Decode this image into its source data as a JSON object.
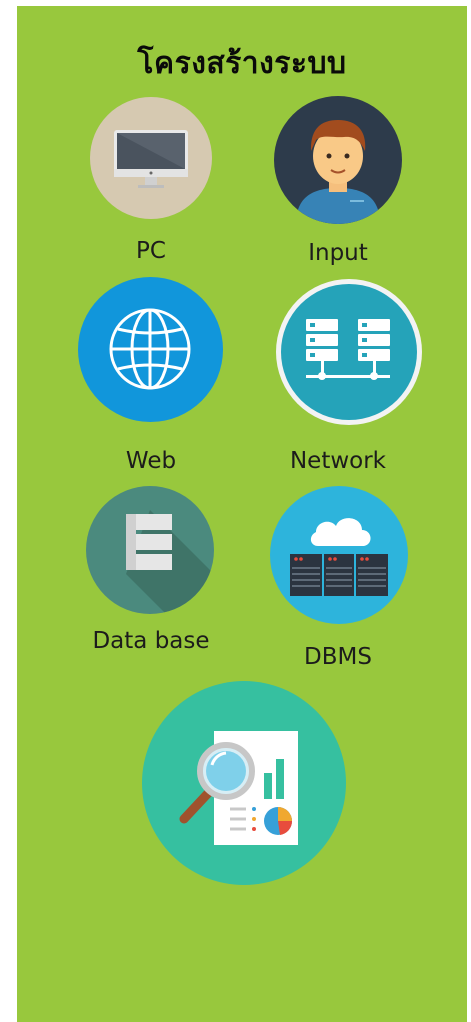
{
  "title": "โครงสร้างระบบ",
  "items": [
    {
      "label": "PC",
      "icon": "monitor-icon",
      "color": "#d6c9b1"
    },
    {
      "label": "Input",
      "icon": "person-avatar-icon",
      "color": "#2d3b4b"
    },
    {
      "label": "Web",
      "icon": "globe-icon",
      "color": "#1196db"
    },
    {
      "label": "Network",
      "icon": "server-network-icon",
      "color": "#25a3b9"
    },
    {
      "label": "Data base",
      "icon": "database-icon",
      "color": "#4b8a7e"
    },
    {
      "label": "DBMS",
      "icon": "cloud-server-icon",
      "color": "#2db4dc"
    },
    {
      "label": "",
      "icon": "analytics-report-icon",
      "color": "#36c0a0"
    }
  ]
}
